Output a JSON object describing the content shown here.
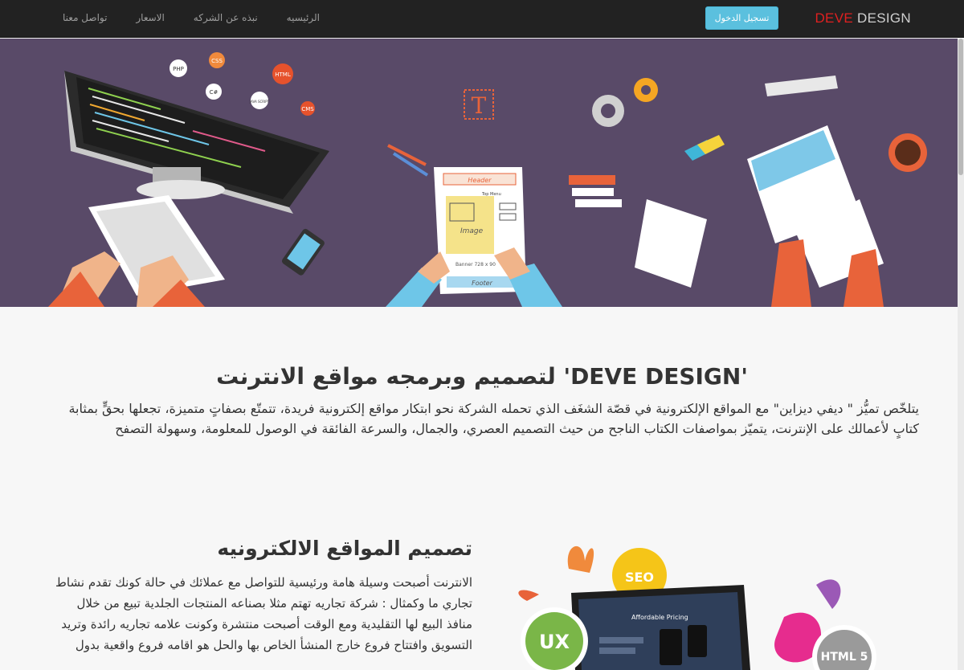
{
  "navbar": {
    "brand_part1": "DEVE",
    "brand_part2": "DESIGN",
    "login_label": "تسجيل الدخول",
    "items": [
      {
        "label": "الرئيسيه"
      },
      {
        "label": "نبذه عن الشركه"
      },
      {
        "label": "الاسعار"
      },
      {
        "label": "تواصل معنا"
      }
    ]
  },
  "hero": {
    "tech_badges": [
      "PHP",
      "CSS",
      "HTML",
      "C#",
      "JAVA SCRIPT",
      "CMS"
    ],
    "paper_header": "Header",
    "paper_image": "Image",
    "paper_footer": "Footer",
    "paper_banner": "Banner 728 x 90",
    "paper_top_menu": "Top Menu",
    "typo_letter": "T",
    "colors": {
      "background": "#594a68",
      "navbar": "#222222",
      "brand_accent": "#e02020",
      "login_button": "#5bc0de"
    }
  },
  "section1": {
    "title": "'DEVE DESIGN' لتصميم وبرمجه مواقع الانترنت",
    "paragraph": "يتلخّص تميُّز \" ديفي ديزاين\" مع المواقع الإلكترونية في قصّة الشغَف الذي تحمله الشركة نحو ابتكار مواقع إلكترونية فريدة، تتمتّع بصفاتٍ متميزة، تجعلها بحقٍّ بمثابة كتابٍ لأعمالك على الإنترنت، يتميّز بمواصفات الكتاب الناجح من حيث التصميم العصري، والجمال، والسرعة الفائقة في الوصول للمعلومة، وسهولة التصفح"
  },
  "section2": {
    "title": "تصميم المواقع الالكترونيه",
    "paragraph": "الانترنت أصبحت وسيلة هامة ورئيسية للتواصل مع عملائك في حالة كونك تقدم نشاط تجاري ما وكمثال : شركة تجاريه تهتم مثلا بصناعه المنتجات الجلدية تبيع من خلال منافذ البيع لها التقليدية ومع الوقت أصبحت منتشرة وكونت علامه تجاريه رائدة وتريد التسويق وافتتاح فروع خارج المنشأ الخاص بها والحل هو اقامه فروع واقعية بدول",
    "badges": {
      "seo": "SEO",
      "ux": "UX",
      "html5": "HTML 5"
    },
    "laptop_text": "Affordable Pricing"
  }
}
